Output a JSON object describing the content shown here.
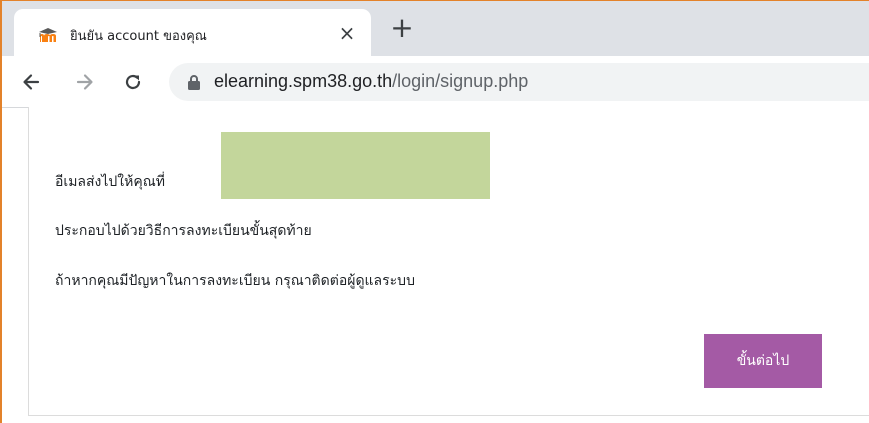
{
  "browser": {
    "tab": {
      "title": "ยินยัน account ของคุณ",
      "favicon": "moodle-icon",
      "close_glyph": "×"
    },
    "new_tab_glyph": "+",
    "toolbar": {
      "back": "arrow-left-icon",
      "forward": "arrow-right-icon",
      "reload": "reload-icon"
    },
    "address": {
      "host": "elearning.spm38.go.th",
      "path": "/login/signup.php"
    }
  },
  "page": {
    "line1": "อีเมลส่งไปให้คุณที่",
    "line2": "ประกอบไปด้วยวิธีการลงทะเบียนขั้นสุดท้าย",
    "line3": "ถ้าหากคุณมีปัญหาในการลงทะเบียน กรุณาติดต่อผู้ดูแลระบบ",
    "continue_button": "ขั้นต่อไป"
  },
  "colors": {
    "frame": "#e3822a",
    "button": "#a45aa5",
    "redaction": "#c3d69b",
    "moodle_orange": "#f98012"
  }
}
